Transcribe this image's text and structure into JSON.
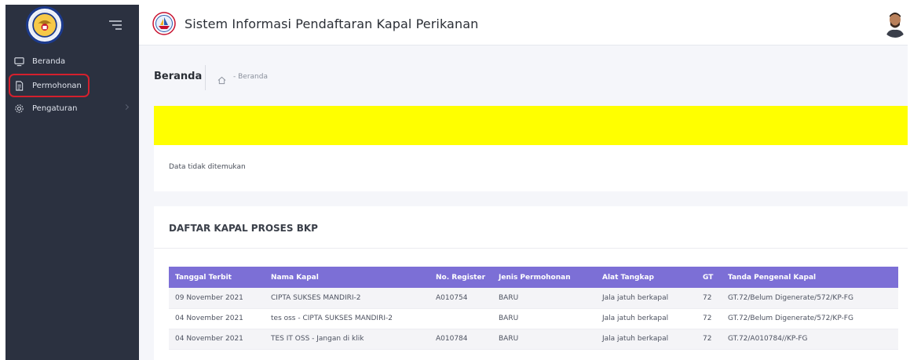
{
  "colors": {
    "sidebar_bg": "#2b3140",
    "table_header_bg": "#7c6fd6",
    "alert_bg": "#ffff00",
    "highlight_border": "#d4202d"
  },
  "sidebar": {
    "logo_icon": "garuda-emblem-icon",
    "toggle_icon": "hamburger-icon",
    "items": [
      {
        "label": "Beranda",
        "icon": "monitor-icon"
      },
      {
        "label": "Permohonan",
        "icon": "document-icon"
      },
      {
        "label": "Pengaturan",
        "icon": "gear-icon"
      }
    ]
  },
  "header": {
    "app_title": "Sistem Informasi Pendaftaran Kapal Perikanan",
    "brand_icon": "ship-emblem-icon",
    "avatar_icon": "user-avatar-icon"
  },
  "breadcrumb": {
    "page_title": "Beranda",
    "home_icon": "home-icon",
    "trail": "- Beranda"
  },
  "alert_card": {
    "message": "Data tidak ditemukan"
  },
  "table_card": {
    "title": "DAFTAR KAPAL PROSES BKP",
    "columns": [
      "Tanggal Terbit",
      "Nama Kapal",
      "No. Register",
      "Jenis Permohonan",
      "Alat Tangkap",
      "GT",
      "Tanda Pengenal Kapal"
    ],
    "rows": [
      [
        "09 November 2021",
        "CIPTA SUKSES MANDIRI-2",
        "A010754",
        "BARU",
        "Jala jatuh berkapal",
        "72",
        "GT.72/Belum Digenerate/572/KP-FG"
      ],
      [
        "04 November 2021",
        "tes oss - CIPTA SUKSES MANDIRI-2",
        "",
        "BARU",
        "Jala jatuh berkapal",
        "72",
        "GT.72/Belum Digenerate/572/KP-FG"
      ],
      [
        "04 November 2021",
        "TES IT OSS - Jangan di klik",
        "A010784",
        "BARU",
        "Jala jatuh berkapal",
        "72",
        "GT.72/A010784//KP-FG"
      ]
    ]
  }
}
